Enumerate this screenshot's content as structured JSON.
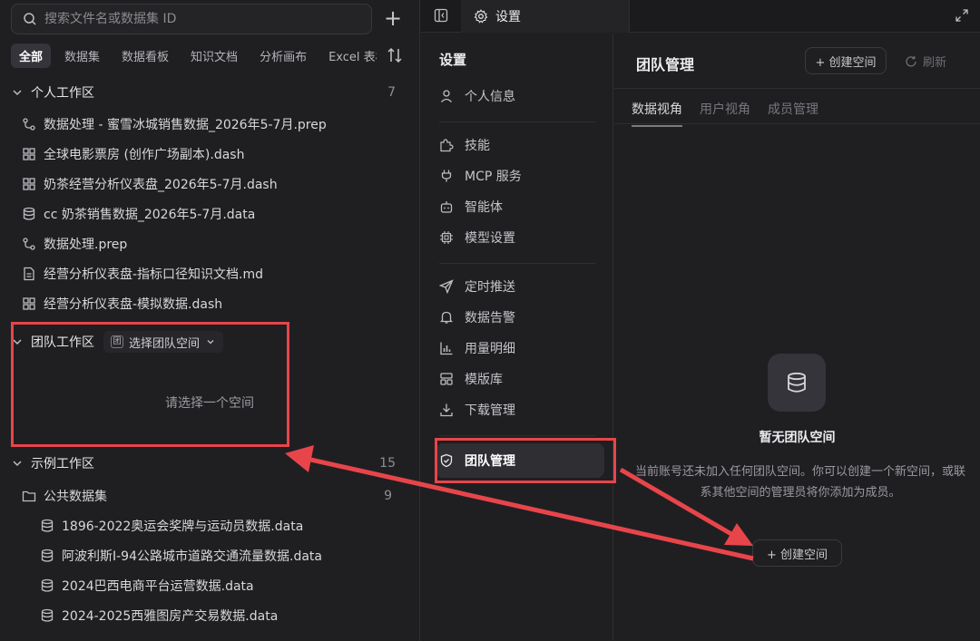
{
  "explorer": {
    "search_placeholder": "搜索文件名或数据集 ID",
    "filters": [
      "全部",
      "数据集",
      "数据看板",
      "知识文档",
      "分析画布",
      "Excel 表格"
    ],
    "personal": {
      "title": "个人工作区",
      "count": "7",
      "files": [
        {
          "name": "数据处理 - 蜜雪冰城销售数据_2026年5-7月.prep",
          "icon": "prep-icon"
        },
        {
          "name": "全球电影票房 (创作广场副本).dash",
          "icon": "dashboard-icon"
        },
        {
          "name": "奶茶经营分析仪表盘_2026年5-7月.dash",
          "icon": "dashboard-icon"
        },
        {
          "name": "cc 奶茶销售数据_2026年5-7月.data",
          "icon": "database-icon"
        },
        {
          "name": "数据处理.prep",
          "icon": "prep-icon"
        },
        {
          "name": "经营分析仪表盘-指标口径知识文档.md",
          "icon": "document-icon"
        },
        {
          "name": "经营分析仪表盘-模拟数据.dash",
          "icon": "dashboard-icon"
        }
      ]
    },
    "team": {
      "title": "团队工作区",
      "tag": "团",
      "select_label": "选择团队空间",
      "empty_text": "请选择一个空间"
    },
    "examples": {
      "title": "示例工作区",
      "count": "15",
      "folder": {
        "name": "公共数据集",
        "count": "9"
      },
      "files": [
        "1896-2022奥运会奖牌与运动员数据.data",
        "阿波利斯I-94公路城市道路交通流量数据.data",
        "2024巴西电商平台运营数据.data",
        "2024-2025西雅图房产交易数据.data"
      ]
    }
  },
  "settings": {
    "tab_label": "设置",
    "nav_title": "设置",
    "nav_items": [
      {
        "label": "个人信息",
        "icon": "user-icon"
      },
      {
        "label": "技能",
        "icon": "puzzle-icon"
      },
      {
        "label": "MCP 服务",
        "icon": "plug-icon"
      },
      {
        "label": "智能体",
        "icon": "bot-icon"
      },
      {
        "label": "模型设置",
        "icon": "chip-icon"
      },
      {
        "label": "定时推送",
        "icon": "send-icon"
      },
      {
        "label": "数据告警",
        "icon": "bell-icon"
      },
      {
        "label": "用量明细",
        "icon": "bar-chart-icon"
      },
      {
        "label": "模版库",
        "icon": "template-icon"
      },
      {
        "label": "下载管理",
        "icon": "download-icon"
      },
      {
        "label": "团队管理",
        "icon": "shield-icon"
      }
    ],
    "main": {
      "title": "团队管理",
      "create_label": "+ 创建空间",
      "refresh_label": "刷新",
      "sub_tabs": [
        "数据视角",
        "用户视角",
        "成员管理"
      ],
      "empty_title": "暂无团队空间",
      "empty_desc": "当前账号还未加入任何团队空间。你可以创建一个新空间，或联系其他空间的管理员将你添加为成员。",
      "empty_create_label": "+ 创建空间"
    }
  },
  "colors": {
    "annotation": "#e8454a",
    "background": "#1f1f22"
  }
}
